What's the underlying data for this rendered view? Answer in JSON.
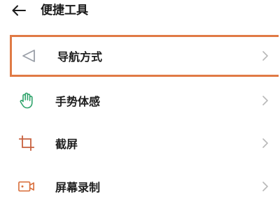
{
  "header": {
    "title": "便捷工具",
    "back_icon": "arrow-left-icon"
  },
  "menu": {
    "items": [
      {
        "label": "导航方式",
        "icon": "navigation-icon",
        "icon_color": "#9a9fa8",
        "highlighted": true
      },
      {
        "label": "手势体感",
        "icon": "hand-gesture-icon",
        "icon_color": "#2fa36b",
        "highlighted": false
      },
      {
        "label": "截屏",
        "icon": "crop-screenshot-icon",
        "icon_color": "#c8603e",
        "highlighted": false
      },
      {
        "label": "屏幕录制",
        "icon": "screen-record-icon",
        "icon_color": "#d9713f",
        "highlighted": false
      }
    ]
  },
  "colors": {
    "highlight_border": "#e07a45",
    "chevron": "#b8b8b8",
    "text": "#1f1f1f"
  }
}
